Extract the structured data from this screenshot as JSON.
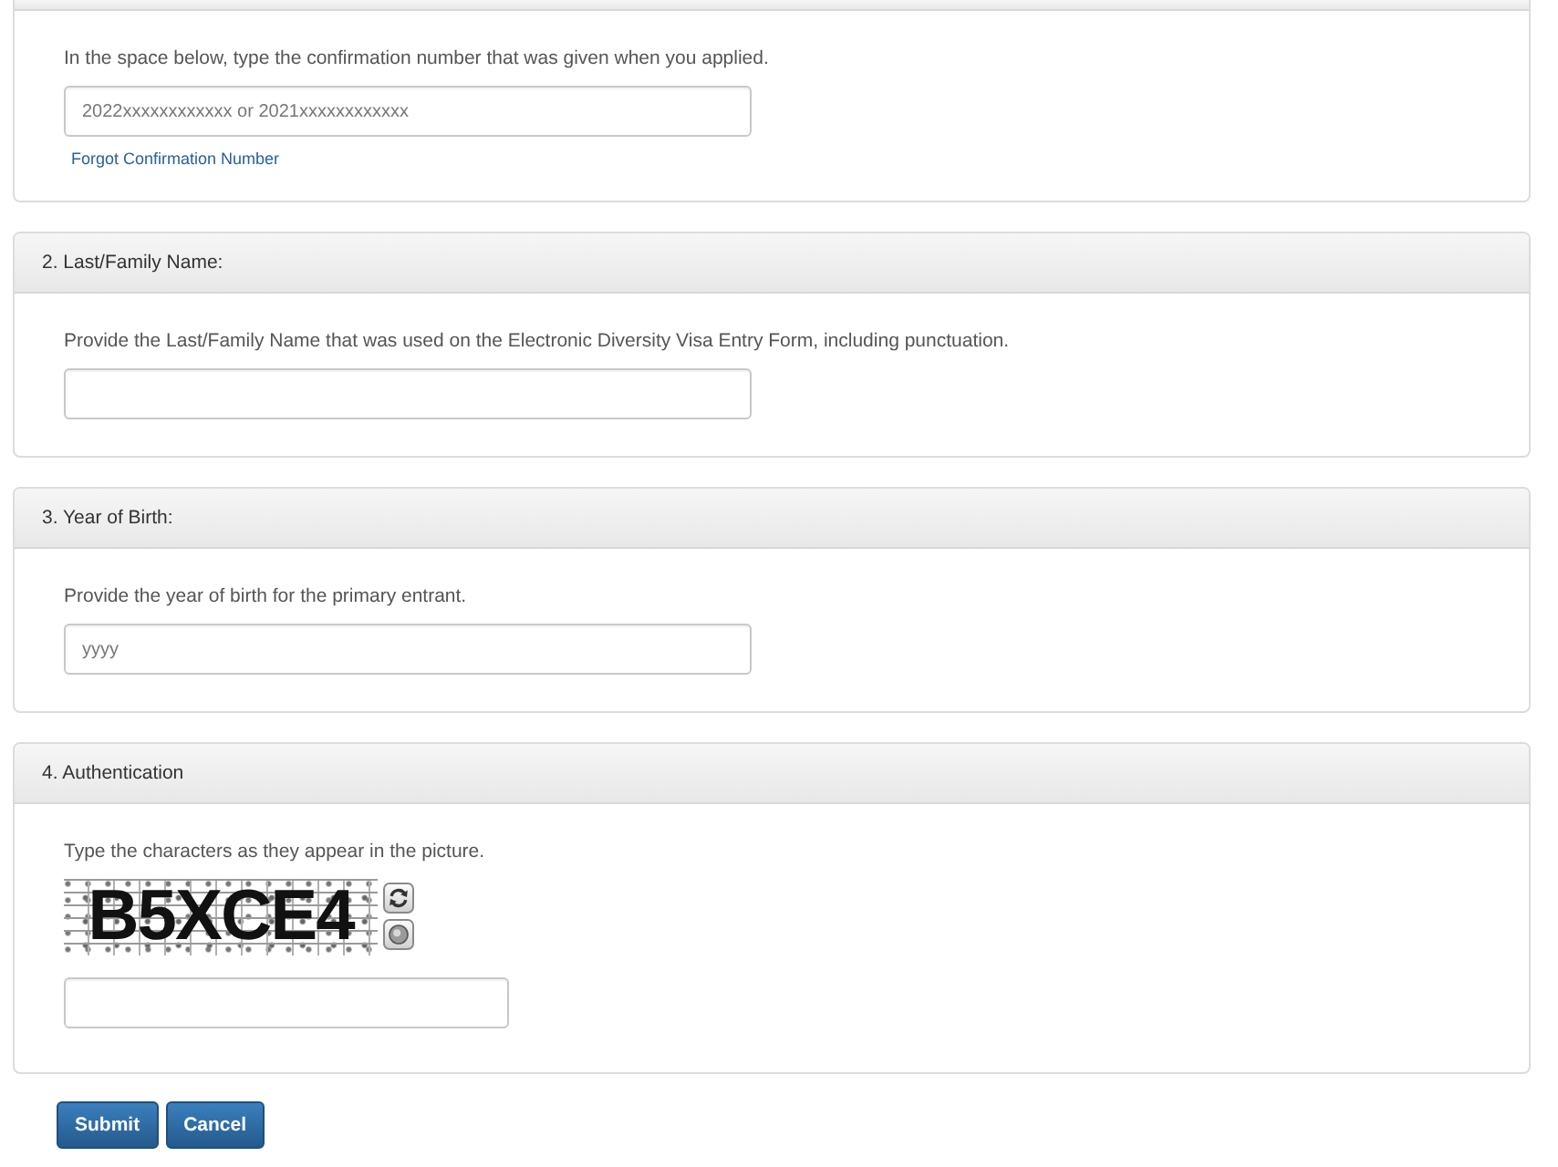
{
  "sections": [
    {
      "kind": "text_input",
      "instruction": "In the space below, type the confirmation number that was given when you applied.",
      "placeholder": "2022xxxxxxxxxxxx or 2021xxxxxxxxxxxx",
      "link": "Forgot Confirmation Number"
    },
    {
      "kind": "text_input",
      "title": "2. Last/Family Name:",
      "instruction": "Provide the Last/Family Name that was used on the Electronic Diversity Visa Entry Form, including punctuation."
    },
    {
      "kind": "text_input",
      "title": "3. Year of Birth:",
      "instruction": "Provide the year of birth for the primary entrant.",
      "placeholder": "yyyy"
    },
    {
      "kind": "captcha",
      "title": "4. Authentication",
      "instruction": "Type the characters as they appear in the picture.",
      "captcha_text": "B5XCE4"
    }
  ],
  "buttons": [
    {
      "label": "Submit"
    },
    {
      "label": "Cancel"
    }
  ]
}
